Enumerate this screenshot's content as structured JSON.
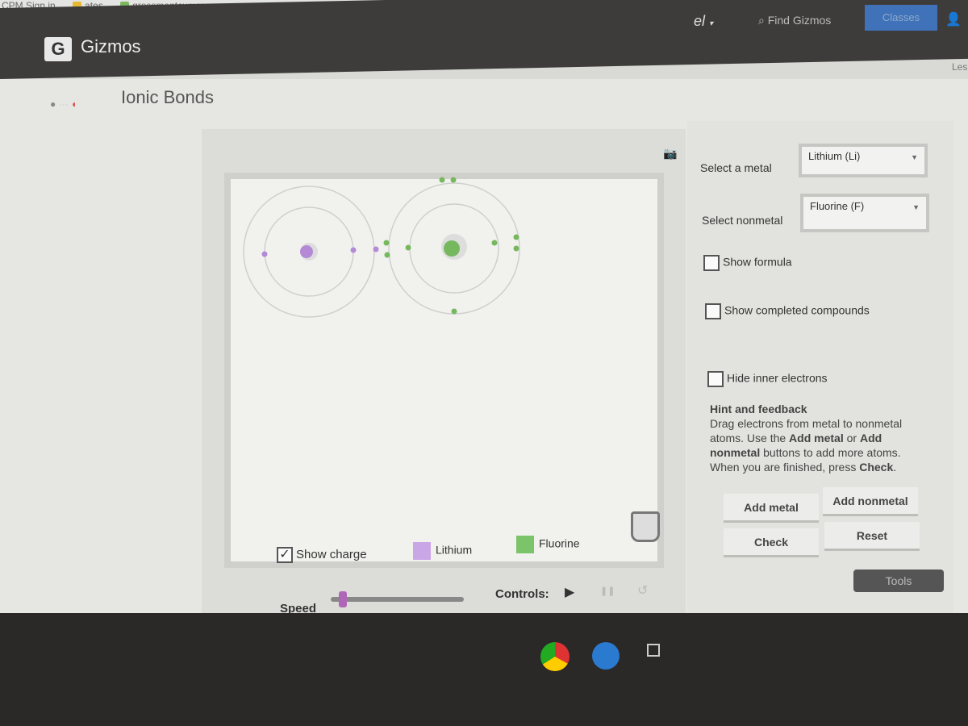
{
  "browser": {
    "bookmarks": [
      "CPM Sign in",
      "ates",
      "grossmontcumm..."
    ]
  },
  "header": {
    "brand": "Gizmos",
    "logo_letter": "G",
    "user_signature": "el",
    "find_placeholder": "Find Gizmos",
    "classes_label": "Classes",
    "partial_link": "Les"
  },
  "gizmo": {
    "title": "Ionic Bonds"
  },
  "sim": {
    "show_charge_label": "Show charge",
    "show_charge_checked": true,
    "legend": [
      {
        "label": "Lithium",
        "color": "#c9a6e6"
      },
      {
        "label": "Fluorine",
        "color": "#7cc46a"
      }
    ],
    "speed_label": "Speed",
    "speed_value": 0.05,
    "controls_label": "Controls:",
    "atoms": [
      {
        "element": "Lithium",
        "color": "#b48ad6",
        "electrons": 3
      },
      {
        "element": "Fluorine",
        "color": "#76b85e",
        "electrons": 9
      }
    ]
  },
  "panel": {
    "metal_label": "Select a metal",
    "metal_value": "Lithium (Li)",
    "nonmetal_label": "Select nonmetal",
    "nonmetal_value": "Fluorine (F)",
    "show_formula": "Show formula",
    "show_completed": "Show completed compounds",
    "hide_inner": "Hide inner electrons",
    "hint_title": "Hint and feedback",
    "hint": {
      "t1": "Drag electrons from metal to nonmetal atoms. Use the ",
      "b1": "Add metal",
      "t2": " or ",
      "b2": "Add nonmetal",
      "t3": " buttons to add more atoms. When you are finished, press ",
      "b3": "Check",
      "t4": "."
    },
    "add_metal": "Add metal",
    "add_nonmetal": "Add nonmetal",
    "check": "Check",
    "reset": "Reset",
    "tools": "Tools"
  }
}
